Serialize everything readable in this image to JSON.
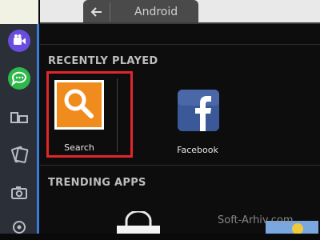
{
  "tab": {
    "title": "Android",
    "back_icon": "back-arrow-icon"
  },
  "sidebar": {
    "items": [
      {
        "name": "video-camera-icon",
        "color": "#6a4de0"
      },
      {
        "name": "chat-icon",
        "color": "#2db84a"
      },
      {
        "name": "multi-window-icon"
      },
      {
        "name": "cards-icon"
      },
      {
        "name": "camera-icon"
      },
      {
        "name": "location-icon"
      }
    ]
  },
  "sections": {
    "recently_played": "RECENTLY PLAYED",
    "trending": "TRENDING APPS"
  },
  "apps": [
    {
      "label": "Search",
      "icon": "search-icon",
      "color": "#f08c1e"
    },
    {
      "label": "Facebook",
      "icon": "facebook-icon",
      "color": "#3b5998"
    }
  ],
  "watermark": "Soft-Arhiv.com"
}
